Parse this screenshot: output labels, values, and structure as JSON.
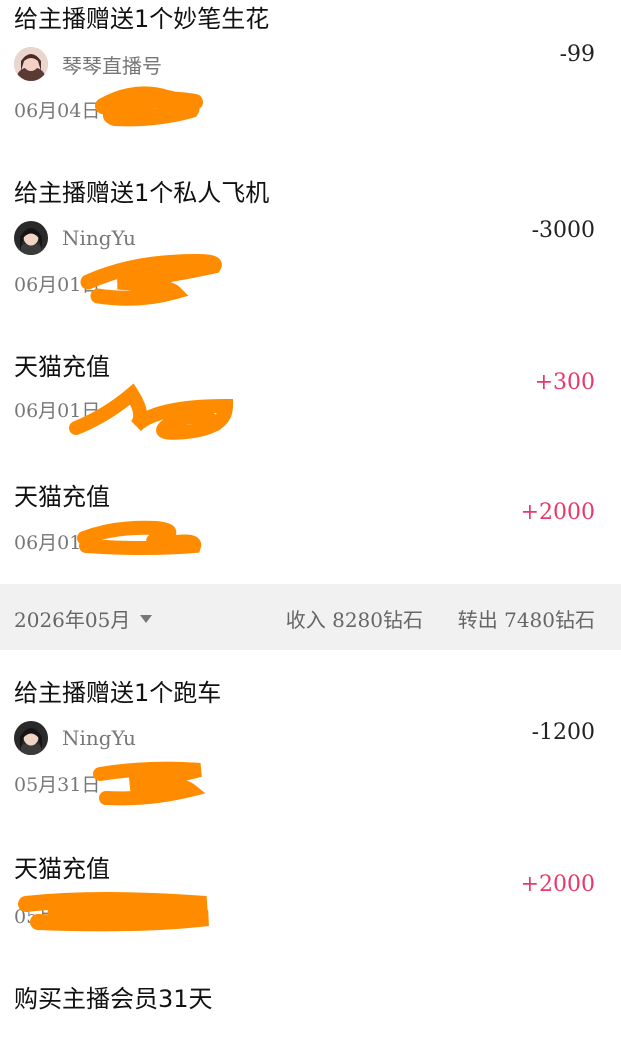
{
  "transactions": [
    {
      "title": "给主播赠送1个妙笔生花",
      "user": "琴琴直播号",
      "date": "06月04日",
      "amount": "-99"
    },
    {
      "title": "给主播赠送1个私人飞机",
      "user": "NingYu",
      "date": "06月01日",
      "amount": "-3000"
    },
    {
      "title": "天猫充值",
      "date": "06月01日",
      "amount": "+300"
    },
    {
      "title": "天猫充值",
      "date": "06月01日",
      "amount": "+2000"
    },
    {
      "title": "给主播赠送1个跑车",
      "user": "NingYu",
      "date": "05月31日",
      "amount": "-1200"
    },
    {
      "title": "天猫充值",
      "date": "05月",
      "amount": "+2000"
    },
    {
      "title": "购买主播会员31天"
    }
  ],
  "month_bar": {
    "month": "2026年05月",
    "income_label": "收入",
    "income_value": "8280钻石",
    "out_label": "转出",
    "out_value": "7480钻石"
  },
  "colors": {
    "positive": "#e8386b",
    "negative": "#222222",
    "redaction": "#ff8c00",
    "month_bar_bg": "#f1f1f1"
  }
}
